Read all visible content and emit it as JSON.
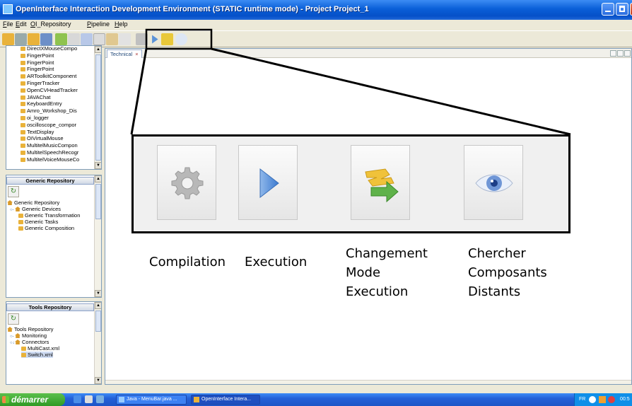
{
  "window": {
    "title": "OpenInterface Interaction Development Environment (STATIC runtime mode) - Project Project_1"
  },
  "menu": [
    "File",
    "Edit",
    "OI_Repository",
    "Pipeline",
    "Help"
  ],
  "left": {
    "components": [
      "DirectXMouseCompo",
      "FingerPoint",
      "FingerPoint",
      "FingerPoint",
      "ARToolkitComponent",
      "FingerTracker",
      "OpenCVHeadTracker",
      "JAVAChat",
      "KeyboardEntry",
      "Amro_Workshop_Dis",
      "oi_logger",
      "oscilloscope_compor",
      "TextDisplay",
      "OIVirtualMouse",
      "MultitelMusicCompon",
      "MultitelSpeechRecogr",
      "MultitelVoiceMouseCo"
    ],
    "generic": {
      "header": "Generic Repository",
      "root": "Generic Repository",
      "devices": "Generic Devices",
      "items": [
        "Generic Transformation",
        "Generic Tasks",
        "Generic Composition"
      ]
    },
    "tools": {
      "header": "Tools Repository",
      "root": "Tools Repository",
      "monitoring": "Monitoring",
      "connectors": "Connectors",
      "items": [
        "MultiCast.xml",
        "Switch.xml"
      ]
    }
  },
  "editor": {
    "tab_label": "Technical",
    "tab_close": "×"
  },
  "callout": {
    "compilation": "Compilation",
    "execution": "Execution",
    "changement": "Changement\nMode\nExecution",
    "chercher": "Chercher\nComposants\nDistants"
  },
  "taskbar": {
    "start_label": "démarrer",
    "tasks": [
      "Java - MenuBar.java ...",
      "OpenInterface Intera..."
    ],
    "tray_lang": "FR",
    "tray_time": "00:5"
  },
  "colors": {
    "titlebar_blue": "#0550c8",
    "start_green": "#2f9a25",
    "panel_border": "#7f9db9",
    "folder_orange": "#e9b23a"
  },
  "icons": [
    "gear-icon",
    "play-icon",
    "switch-mode-icon",
    "eye-icon",
    "refresh-icon",
    "folder-icon",
    "home-icon"
  ]
}
